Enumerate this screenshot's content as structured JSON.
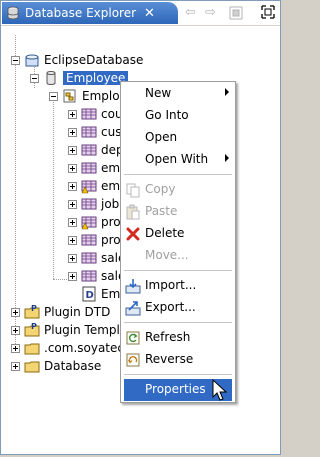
{
  "view": {
    "title": "Database Explorer",
    "close_glyph": "✕",
    "toolbar_icons": [
      "back-arrow-icon",
      "forward-arrow-icon",
      "link-icon"
    ],
    "maximize_icon": "maximize-icon"
  },
  "tree": {
    "items": [
      {
        "label": "EclipseDatabase"
      },
      {
        "label": "Employee"
      },
      {
        "label": "Employee"
      },
      {
        "label": "cou"
      },
      {
        "label": "cus"
      },
      {
        "label": "dep"
      },
      {
        "label": "em"
      },
      {
        "label": "em"
      },
      {
        "label": "job"
      },
      {
        "label": "pro"
      },
      {
        "label": "pro"
      },
      {
        "label": "sale"
      },
      {
        "label": "sale"
      },
      {
        "label": "Em"
      },
      {
        "label": "Plugin DTD"
      },
      {
        "label": "Plugin Templat"
      },
      {
        "label": ".com.soyatec"
      },
      {
        "label": "Database"
      }
    ]
  },
  "context_menu": {
    "items": [
      {
        "label": "New"
      },
      {
        "label": "Go Into"
      },
      {
        "label": "Open"
      },
      {
        "label": "Open With"
      },
      {
        "label": "Copy"
      },
      {
        "label": "Paste"
      },
      {
        "label": "Delete"
      },
      {
        "label": "Move..."
      },
      {
        "label": "Import..."
      },
      {
        "label": "Export..."
      },
      {
        "label": "Refresh"
      },
      {
        "label": "Reverse"
      },
      {
        "label": "Properties"
      }
    ]
  },
  "colors": {
    "selection": "#316ac5",
    "tab_blue": "#2e67b8",
    "disabled_text": "#a0a0a0",
    "frame": "#7f9db9"
  }
}
